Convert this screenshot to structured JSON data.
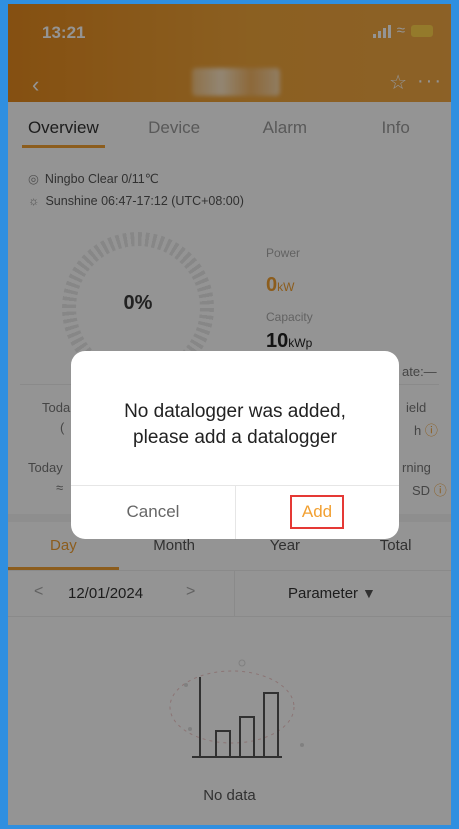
{
  "status_bar": {
    "time": "13:21"
  },
  "header": {
    "back_icon": "chevron-left-icon",
    "favorite_icon": "star-outline-icon",
    "more_icon": "more-horizontal-icon"
  },
  "tabs": [
    {
      "label": "Overview"
    },
    {
      "label": "Device"
    },
    {
      "label": "Alarm"
    },
    {
      "label": "Info"
    }
  ],
  "overview": {
    "weather_line": "Ningbo Clear 0/11℃",
    "sunshine_line": "Sunshine 06:47-17:12 (UTC+08:00)",
    "gauge_percent": "0%",
    "power_label": "Power",
    "power_value": "0",
    "power_unit": "kW",
    "capacity_label": "Capacity",
    "capacity_value": "10",
    "capacity_unit": "kWp",
    "peek": {
      "rate": "ate:—",
      "today_left": "Toda",
      "today_left_val": "(",
      "yield": "ield",
      "yield_unit": "h",
      "today2_left": "Today",
      "today2_left_val": "≈",
      "earning": "rning",
      "earning_unit": "SD"
    }
  },
  "period_tabs": [
    {
      "label": "Day"
    },
    {
      "label": "Month"
    },
    {
      "label": "Year"
    },
    {
      "label": "Total"
    }
  ],
  "date_bar": {
    "date": "12/01/2024",
    "parameter_label": "Parameter"
  },
  "chart_area": {
    "empty_text": "No data"
  },
  "dialog": {
    "message_line1": "No datalogger was added,",
    "message_line2": "please add a datalogger",
    "cancel_label": "Cancel",
    "add_label": "Add"
  },
  "colors": {
    "accent": "#f2a032",
    "highlight_border": "#e53935",
    "frame": "#2f8fe0"
  }
}
